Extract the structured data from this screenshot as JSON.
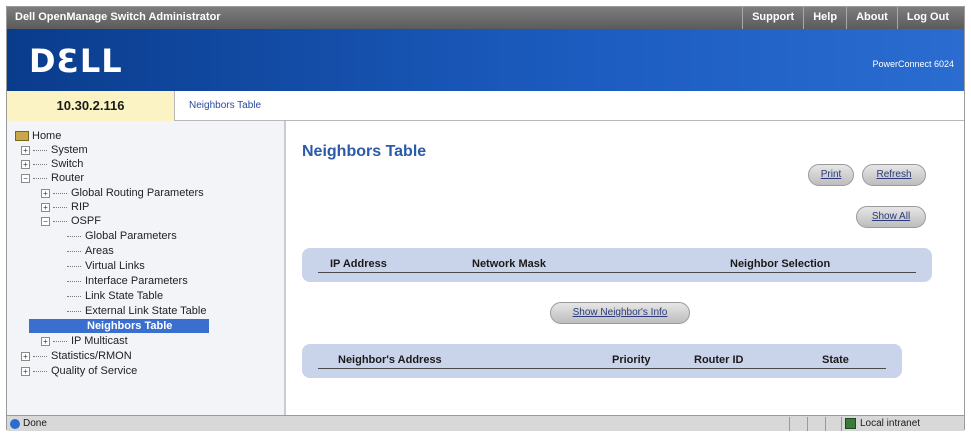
{
  "app": {
    "title": "Dell OpenManage Switch Administrator",
    "top_links": [
      "Support",
      "Help",
      "About",
      "Log Out"
    ],
    "logo": "DƐLL",
    "model": "PowerConnect 6024"
  },
  "address": {
    "ip": "10.30.2.116",
    "breadcrumb": "Neighbors Table"
  },
  "nav": {
    "home": "Home",
    "items": {
      "system": "System",
      "switch": "Switch",
      "router": "Router",
      "global_routing": "Global Routing Parameters",
      "rip": "RIP",
      "ospf": "OSPF",
      "global_parameters": "Global Parameters",
      "areas": "Areas",
      "virtual_links": "Virtual Links",
      "interface_parameters": "Interface Parameters",
      "link_state_table": "Link State Table",
      "external_link_state_table": "External Link State Table",
      "neighbors_table": "Neighbors Table",
      "ip_multicast": "IP Multicast",
      "statistics_rmon": "Statistics/RMON",
      "quality_of_service": "Quality of Service"
    },
    "expanders": {
      "plus": "+",
      "minus": "−"
    }
  },
  "main": {
    "title": "Neighbors Table",
    "buttons": {
      "print": "Print",
      "refresh": "Refresh",
      "show_all": "Show All",
      "show_neighbor_info": "Show Neighbor's Info"
    },
    "table1_headers": [
      "IP Address",
      "Network Mask",
      "Neighbor Selection"
    ],
    "table2_headers": [
      "Neighbor's Address",
      "Priority",
      "Router ID",
      "State"
    ]
  },
  "status": {
    "text": "Done",
    "zone": "Local intranet"
  },
  "colors": {
    "banner": "#1c5cc0",
    "title_blue": "#2a5aa8",
    "table_bar": "#c9d3ea",
    "ip_box": "#fbf3c4",
    "selected": "#3a6fd0"
  }
}
